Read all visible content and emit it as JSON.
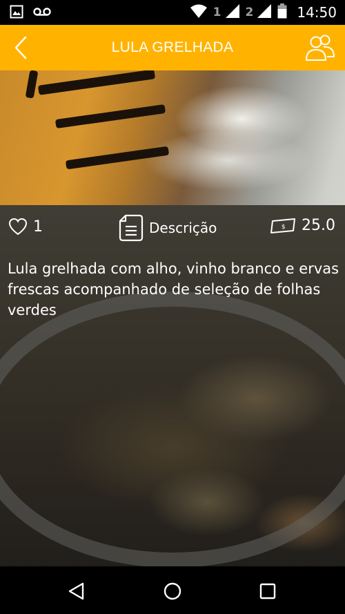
{
  "status_bar": {
    "sim1_label": "1",
    "sim2_label": "2",
    "time": "14:50",
    "icons": [
      "image-icon",
      "voicemail-icon",
      "wifi-icon",
      "signal-icon",
      "battery-icon"
    ]
  },
  "toolbar": {
    "title": "LULA GRELHADA",
    "back_icon": "chevron-left-icon",
    "people_icon": "people-icon",
    "background_color": "#FFB300"
  },
  "info": {
    "likes": "1",
    "description_label": "Descrição",
    "price": "25.0"
  },
  "dish": {
    "description": "Lula grelhada com alho, vinho branco e ervas frescas acompanhado de seleção de folhas verdes"
  },
  "nav_bar": {
    "icons": [
      "back-triangle-icon",
      "home-circle-icon",
      "recents-square-icon"
    ]
  }
}
